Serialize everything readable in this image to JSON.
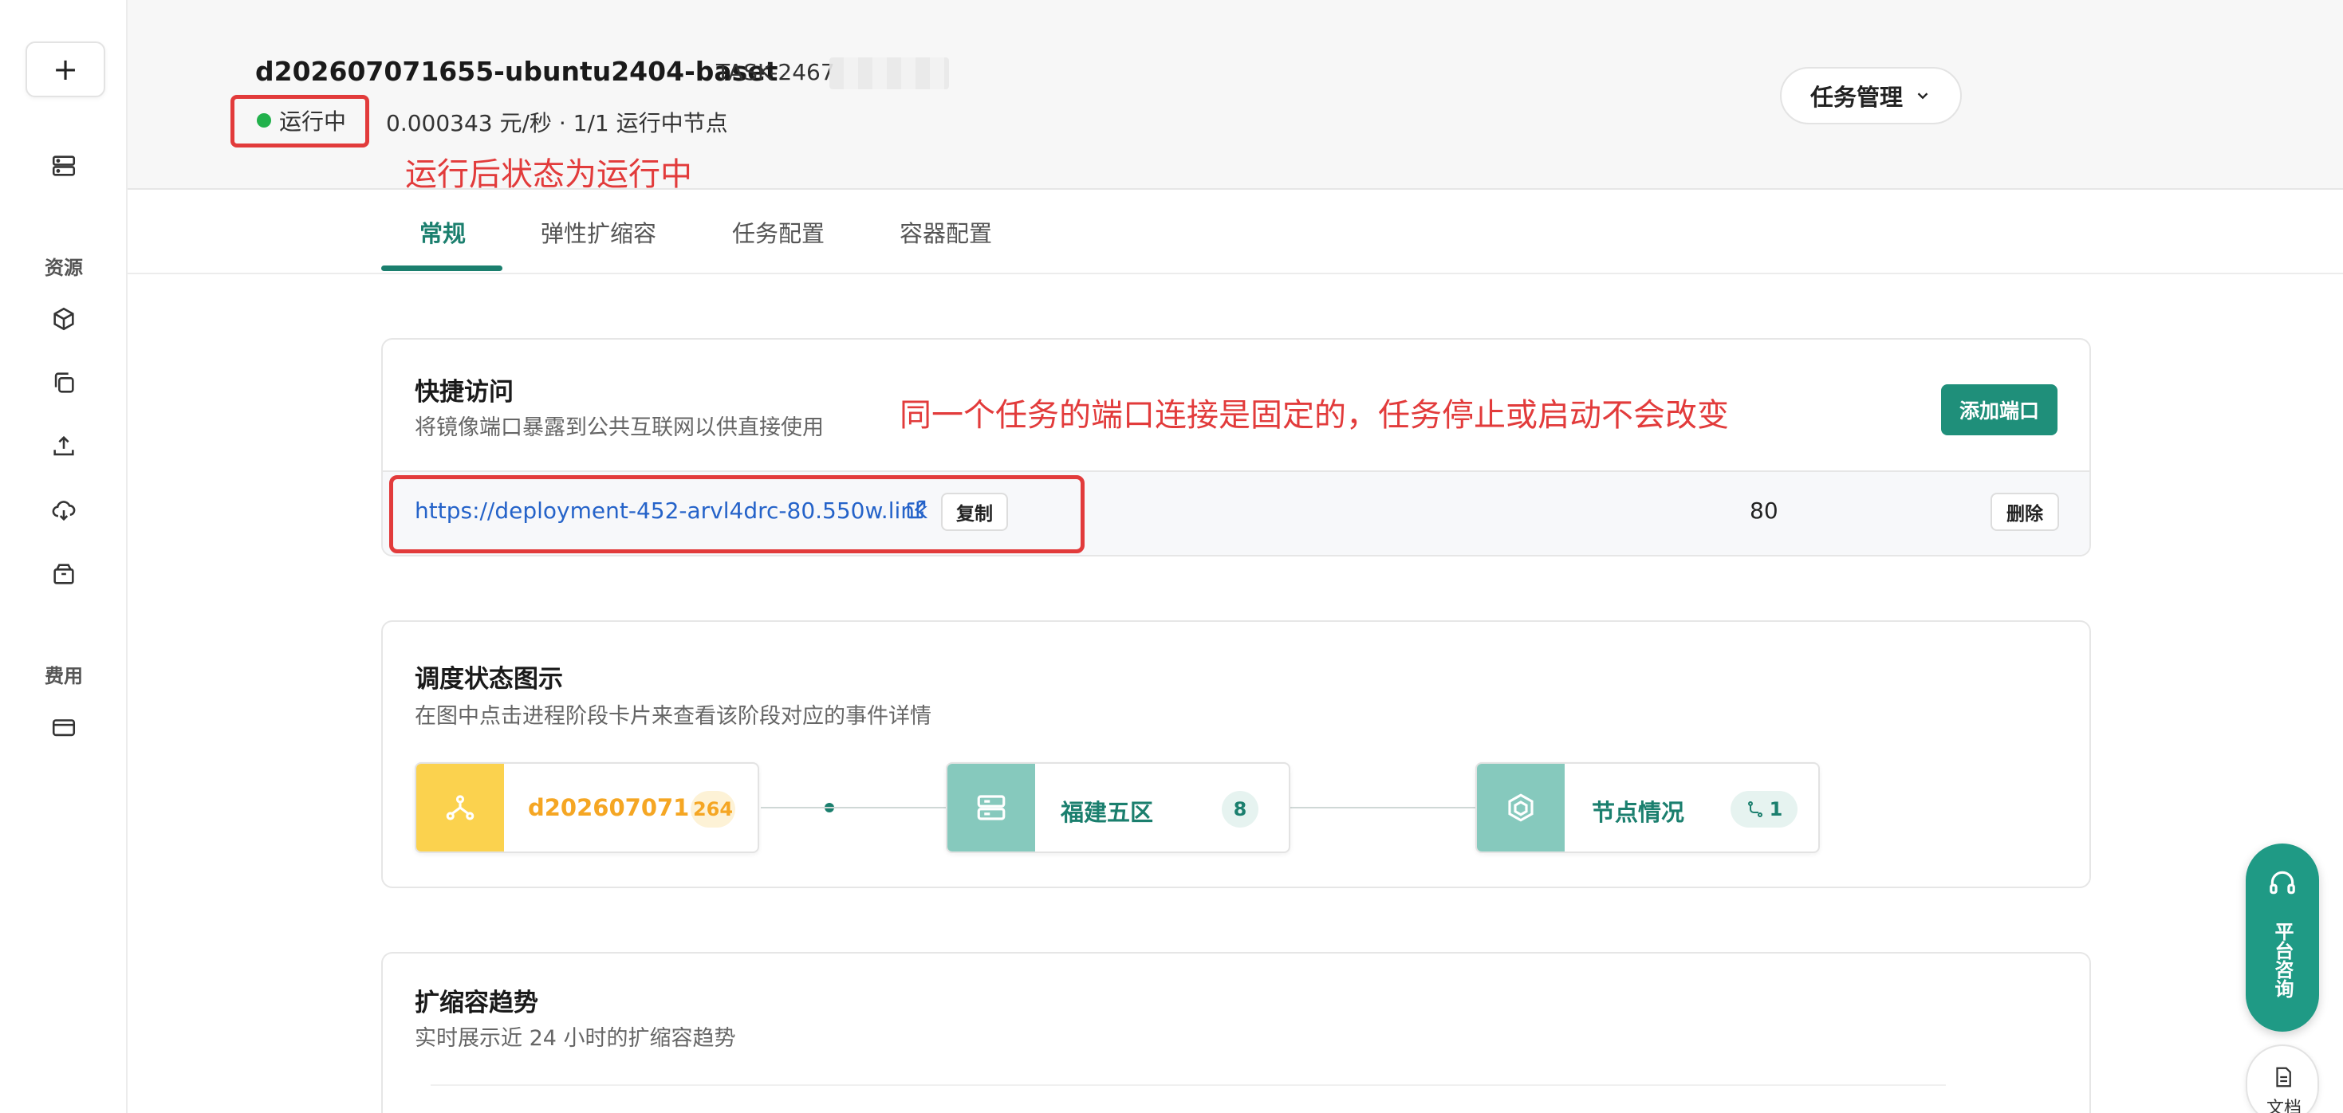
{
  "sidebar": {
    "add_label": "+",
    "section_resources": "资源",
    "section_billing": "费用"
  },
  "header": {
    "title": "d202607071655-ubuntu2404-baset",
    "task_id": "TASK-2467",
    "status": "运行中",
    "price": "0.000343 元/秒 · 1/1 运行中节点",
    "annotation": "运行后状态为运行中",
    "manage_button": "任务管理",
    "status_color": "#22b14c"
  },
  "tabs": [
    {
      "label": "常规",
      "active": true
    },
    {
      "label": "弹性扩缩容",
      "active": false
    },
    {
      "label": "任务配置",
      "active": false
    },
    {
      "label": "容器配置",
      "active": false
    }
  ],
  "quick_access": {
    "title": "快捷访问",
    "subtitle": "将镜像端口暴露到公共互联网以供直接使用",
    "annotation": "同一个任务的端口连接是固定的，任务停止或启动不会改变",
    "add_port_button": "添加端口",
    "ports": [
      {
        "url": "https://deployment-452-arvl4drc-80.550w.link",
        "copy_label": "复制",
        "port": "80",
        "delete_label": "删除"
      }
    ]
  },
  "schedule": {
    "title": "调度状态图示",
    "subtitle": "在图中点击进程阶段卡片来查看该阶段对应的事件详情",
    "nodes": [
      {
        "label": "d202607071...",
        "badge": "264",
        "icon": "cluster-icon",
        "color": "#f5b82e"
      },
      {
        "label": "福建五区",
        "badge": "8",
        "icon": "server-icon",
        "color": "#1b7f6e"
      },
      {
        "label": "节点情况",
        "badge": "1",
        "icon": "hex-node-icon",
        "color": "#1b7f6e"
      }
    ]
  },
  "scaling_trend": {
    "title": "扩缩容趋势",
    "subtitle": "实时展示近 24 小时的扩缩容趋势"
  },
  "floating": {
    "consult_label": "平台咨询",
    "doc_label": "文档"
  },
  "colors": {
    "accent": "#1b7f6e",
    "annotation_red": "#e23b3b",
    "link_blue": "#2563c9"
  }
}
